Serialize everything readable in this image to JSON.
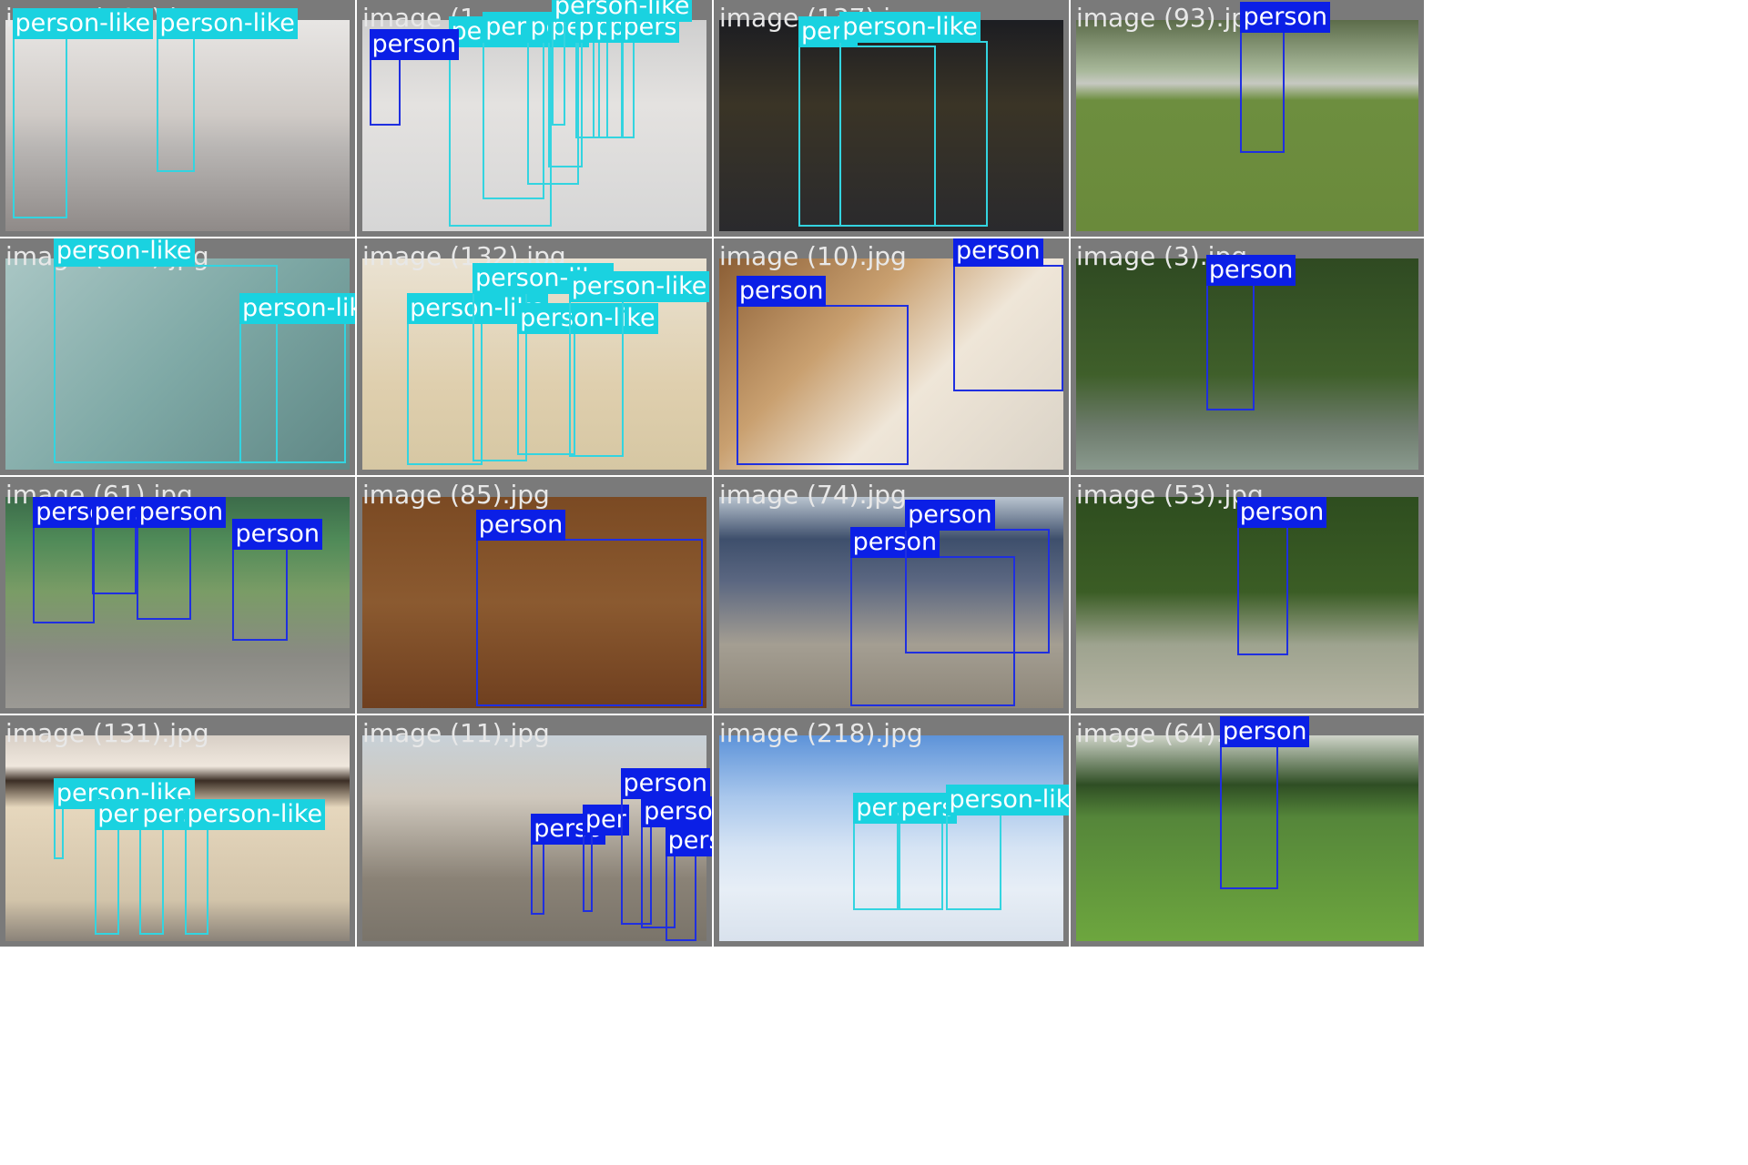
{
  "tiles": [
    {
      "file": "image (164).jpg",
      "bg": "linear-gradient(180deg,#e8e6e4 0%,#cfcac6 45%,#b9b6b4 60%,#8f8a88 100%)",
      "boxes": [
        {
          "label": "person-like",
          "cls": "like",
          "l": 2,
          "t": 8,
          "w": 16,
          "h": 86
        },
        {
          "label": "person-like",
          "cls": "like",
          "l": 44,
          "t": 8,
          "w": 11,
          "h": 64
        }
      ]
    },
    {
      "file": "image (1",
      "bg": "linear-gradient(180deg,#cfcfcf 0%,#e4e2e0 40%,#d6d6d6 100%)",
      "boxes": [
        {
          "label": "person-like",
          "cls": "like",
          "l": 25,
          "t": 12,
          "w": 30,
          "h": 86
        },
        {
          "label": "person-like",
          "cls": "like",
          "l": 35,
          "t": 10,
          "w": 18,
          "h": 75
        },
        {
          "label": "perso",
          "cls": "like",
          "l": 48,
          "t": 10,
          "w": 15,
          "h": 68
        },
        {
          "label": "perso",
          "cls": "like",
          "l": 54,
          "t": 10,
          "w": 10,
          "h": 60
        },
        {
          "label": "per",
          "cls": "like",
          "l": 62,
          "t": 10,
          "w": 7,
          "h": 46
        },
        {
          "label": "pe",
          "cls": "like",
          "l": 67,
          "t": 10,
          "w": 9,
          "h": 46
        },
        {
          "label": "pe",
          "cls": "like",
          "l": 71,
          "t": 10,
          "w": 8,
          "h": 46
        },
        {
          "label": "pers",
          "cls": "like",
          "l": 75,
          "t": 10,
          "w": 4,
          "h": 46
        },
        {
          "label": "person-like",
          "cls": "like",
          "l": 55,
          "t": 0,
          "w": 4,
          "h": 50
        },
        {
          "label": "person",
          "cls": "person",
          "l": 2,
          "t": 18,
          "w": 9,
          "h": 32
        }
      ]
    },
    {
      "file": "image (137).jpg",
      "bg": "linear-gradient(180deg,#1c1d22 0%,#3a3426 40%,#2a2a2d 100%)",
      "boxes": [
        {
          "label": "pers",
          "cls": "like",
          "l": 23,
          "t": 12,
          "w": 40,
          "h": 86
        },
        {
          "label": "person-like",
          "cls": "like",
          "l": 35,
          "t": 10,
          "w": 43,
          "h": 88
        },
        {
          "label": "person-like",
          "cls": "like",
          "l": 0,
          "t": 0,
          "w": 0,
          "h": 0
        }
      ]
    },
    {
      "file": "image (93).jpg",
      "bg": "linear-gradient(180deg,#5c6c4a 0%,#a8b89a 24%,#c7c9c2 30%,#6d8e3f 38%,#6a8a3b 100%)",
      "boxes": [
        {
          "label": "person",
          "cls": "person",
          "l": 48,
          "t": 5,
          "w": 13,
          "h": 58
        }
      ]
    },
    {
      "file": "image (113).jpg",
      "bg": "linear-gradient(135deg,#a9c6c4 0%,#7fa9a6 50%,#5f8785 100%)",
      "boxes": [
        {
          "label": "person-like",
          "cls": "like",
          "l": 14,
          "t": 3,
          "w": 65,
          "h": 94
        },
        {
          "label": "person-like",
          "cls": "like",
          "l": 68,
          "t": 30,
          "w": 31,
          "h": 67
        }
      ]
    },
    {
      "file": "image (132).jpg",
      "bg": "linear-gradient(180deg,#eae2d2 0%,#dfcfae 60%,#d6c7a3 100%)",
      "boxes": [
        {
          "label": "person-like",
          "cls": "like",
          "l": 13,
          "t": 30,
          "w": 22,
          "h": 68
        },
        {
          "label": "person-like",
          "cls": "like",
          "l": 32,
          "t": 16,
          "w": 16,
          "h": 80
        },
        {
          "label": "person-like",
          "cls": "like",
          "l": 45,
          "t": 35,
          "w": 17,
          "h": 58
        },
        {
          "label": "person-like",
          "cls": "like",
          "l": 60,
          "t": 20,
          "w": 16,
          "h": 74
        },
        {
          "label": "person-like",
          "cls": "like",
          "l": 0,
          "t": 0,
          "w": 0,
          "h": 0
        }
      ]
    },
    {
      "file": "image (10).jpg",
      "bg": "linear-gradient(135deg,#8b5e35 0%,#c9a070 35%,#efe6d8 60%,#d9d2c6 100%)",
      "boxes": [
        {
          "label": "person",
          "cls": "person",
          "l": 5,
          "t": 22,
          "w": 50,
          "h": 76
        },
        {
          "label": "person",
          "cls": "person",
          "l": 68,
          "t": 3,
          "w": 32,
          "h": 60
        }
      ]
    },
    {
      "file": "image (3).jpg",
      "bg": "linear-gradient(180deg,#2f4a22 0%,#3f5f2a 55%,#6d7b6c 80%,#8a9a8e 100%)",
      "boxes": [
        {
          "label": "person",
          "cls": "person",
          "l": 38,
          "t": 12,
          "w": 14,
          "h": 60
        }
      ]
    },
    {
      "file": "image (61).jpg",
      "bg": "linear-gradient(180deg,#3c6b4a 0%,#4f8a58 20%,#7a9c66 45%,#8a8a84 75%,#9c9a95 100%)",
      "boxes": [
        {
          "label": "person",
          "cls": "person",
          "l": 8,
          "t": 14,
          "w": 18,
          "h": 46
        },
        {
          "label": "person",
          "cls": "person",
          "l": 25,
          "t": 14,
          "w": 13,
          "h": 32
        },
        {
          "label": "person",
          "cls": "person",
          "l": 38,
          "t": 14,
          "w": 16,
          "h": 44
        },
        {
          "label": "person",
          "cls": "person",
          "l": 66,
          "t": 24,
          "w": 16,
          "h": 44
        }
      ]
    },
    {
      "file": "image (85).jpg",
      "bg": "linear-gradient(180deg,#7b4a23 0%,#8b5a30 50%,#6f3f1f 100%)",
      "boxes": [
        {
          "label": "person",
          "cls": "person",
          "l": 33,
          "t": 20,
          "w": 66,
          "h": 79
        }
      ]
    },
    {
      "file": "image (74).jpg",
      "bg": "linear-gradient(180deg,#b9c4cf 0%,#3e4f6c 20%,#5b6781 40%,#a49e92 70%,#8d8679 100%)",
      "boxes": [
        {
          "label": "person",
          "cls": "person",
          "l": 38,
          "t": 28,
          "w": 48,
          "h": 71
        },
        {
          "label": "person",
          "cls": "person",
          "l": 54,
          "t": 15,
          "w": 42,
          "h": 59
        }
      ]
    },
    {
      "file": "image (53).jpg",
      "bg": "linear-gradient(180deg,#2e4d1f 0%,#3b5d25 45%,#9ea38f 70%,#b6b5a4 100%)",
      "boxes": [
        {
          "label": "person",
          "cls": "person",
          "l": 47,
          "t": 14,
          "w": 15,
          "h": 61
        }
      ]
    },
    {
      "file": "image (131).jpg",
      "bg": "linear-gradient(180deg,#d8cfc6 0%,#efe7dd 15%,#3b2e25 22%,#e6d7bd 35%,#d2c4aa 80%,#8b8379 100%)",
      "boxes": [
        {
          "label": "person-like",
          "cls": "like",
          "l": 14,
          "t": 35,
          "w": 3,
          "h": 25
        },
        {
          "label": "person-like",
          "cls": "like",
          "l": 26,
          "t": 45,
          "w": 7,
          "h": 52
        },
        {
          "label": "person-like",
          "cls": "like",
          "l": 39,
          "t": 45,
          "w": 7,
          "h": 52
        },
        {
          "label": "person-like",
          "cls": "like",
          "l": 52,
          "t": 45,
          "w": 7,
          "h": 52
        }
      ]
    },
    {
      "file": "image (11).jpg",
      "bg": "linear-gradient(180deg,#c8d1d8 0%,#cfc8bd 30%,#8a8276 70%,#7a746a 100%)",
      "boxes": [
        {
          "label": "perso",
          "cls": "person",
          "l": 49,
          "t": 52,
          "w": 4,
          "h": 35
        },
        {
          "label": "per",
          "cls": "person",
          "l": 64,
          "t": 48,
          "w": 3,
          "h": 38
        },
        {
          "label": "person",
          "cls": "person",
          "l": 75,
          "t": 30,
          "w": 9,
          "h": 62
        },
        {
          "label": "person",
          "cls": "person",
          "l": 81,
          "t": 44,
          "w": 10,
          "h": 50
        },
        {
          "label": "person",
          "cls": "person",
          "l": 88,
          "t": 58,
          "w": 9,
          "h": 42
        }
      ]
    },
    {
      "file": "image (218).jpg",
      "bg": "linear-gradient(180deg,#5d93d9 0%,#a9c7ec 30%,#d6e4f4 55%,#e7eef6 75%,#d9e2ed 100%)",
      "boxes": [
        {
          "label": "pers",
          "cls": "like",
          "l": 39,
          "t": 42,
          "w": 13,
          "h": 43
        },
        {
          "label": "pers",
          "cls": "like",
          "l": 52,
          "t": 42,
          "w": 13,
          "h": 43
        },
        {
          "label": "person-like",
          "cls": "like",
          "l": 66,
          "t": 38,
          "w": 16,
          "h": 47
        }
      ]
    },
    {
      "file": "image (64).jpg",
      "bg": "linear-gradient(180deg,#cfd4c9 0%,#2f4e24 24%,#55863a 40%,#6da63e 100%)",
      "boxes": [
        {
          "label": "person",
          "cls": "person",
          "l": 42,
          "t": 5,
          "w": 17,
          "h": 70
        }
      ]
    }
  ]
}
